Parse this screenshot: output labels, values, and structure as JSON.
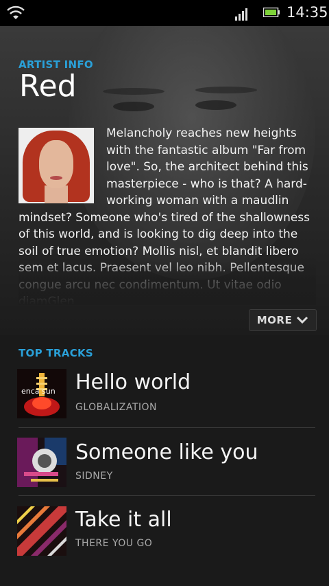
{
  "status_bar": {
    "time": "14:35",
    "icons": [
      "wifi-icon",
      "signal-icon",
      "battery-icon"
    ]
  },
  "artist": {
    "section_label": "ARTIST INFO",
    "name": "Red",
    "bio": "Melancholy reaches new heights with the fantastic album \"Far from love\". So, the architect behind this masterpiece - who is that? A hard-working woman with a maudlin mindset? Someone who's tired of the shallowness of this world, and is looking to dig deep into the soil of true emotion? Mollis nisl, et blandit libero sem et lacus. Praesent vel leo nibh. Pellentesque congue arcu nec condimentum. Ut vitae odio diamGlen",
    "more_label": "MORE"
  },
  "top_tracks": {
    "section_label": "TOP TRACKS",
    "items": [
      {
        "title": "Hello world",
        "subtitle": "GLOBALIZATION",
        "art_text": "enca sun"
      },
      {
        "title": "Someone like you",
        "subtitle": "SIDNEY"
      },
      {
        "title": "Take it all",
        "subtitle": "THERE YOU GO"
      }
    ]
  },
  "colors": {
    "accent": "#2aa0d8",
    "background": "#1a1a1a",
    "text": "#f2f2f2",
    "subtext": "#a9a9a9"
  }
}
